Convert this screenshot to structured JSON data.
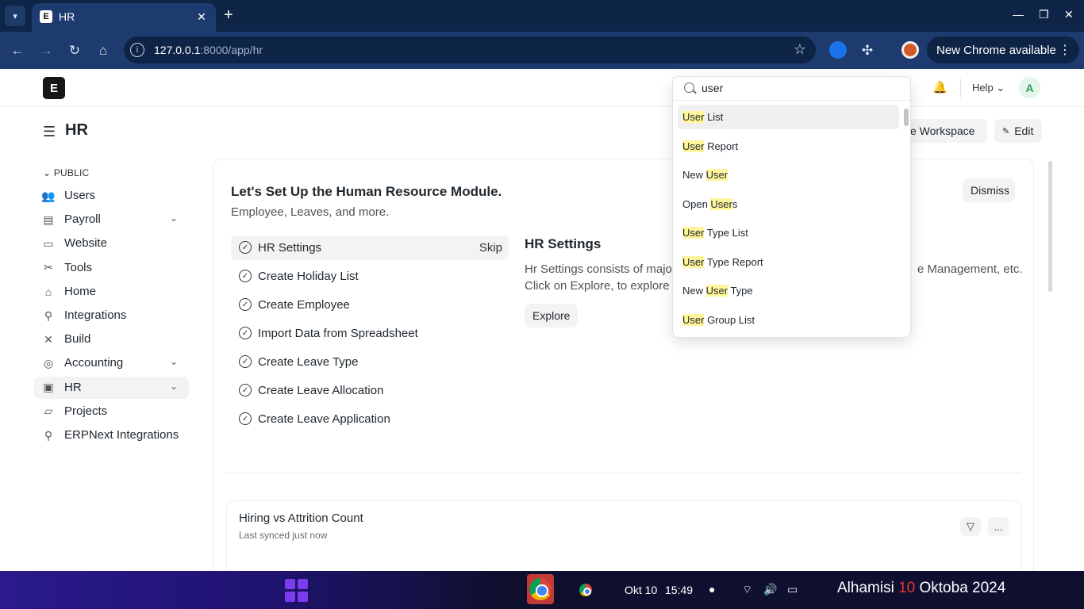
{
  "browser": {
    "tab_title": "HR",
    "tab_favicon": "E",
    "new_tab": "+",
    "url_host": "127.0.0.1",
    "url_path": ":8000/app/hr",
    "update_label": "New Chrome available"
  },
  "app": {
    "logo": "E",
    "help_label": "Help",
    "avatar_initial": "A"
  },
  "page": {
    "title": "HR",
    "workspace_button": "e Workspace",
    "edit_button": "Edit"
  },
  "sidebar": {
    "section": "PUBLIC",
    "items": [
      {
        "label": "Users",
        "icon": "users-icon",
        "chevron": false
      },
      {
        "label": "Payroll",
        "icon": "payroll-icon",
        "chevron": true
      },
      {
        "label": "Website",
        "icon": "website-icon",
        "chevron": false
      },
      {
        "label": "Tools",
        "icon": "tools-icon",
        "chevron": false
      },
      {
        "label": "Home",
        "icon": "home-icon",
        "chevron": false
      },
      {
        "label": "Integrations",
        "icon": "integrations-icon",
        "chevron": false
      },
      {
        "label": "Build",
        "icon": "build-icon",
        "chevron": false
      },
      {
        "label": "Accounting",
        "icon": "accounting-icon",
        "chevron": true
      },
      {
        "label": "HR",
        "icon": "hr-icon",
        "chevron": true
      },
      {
        "label": "Projects",
        "icon": "folder-icon",
        "chevron": false
      },
      {
        "label": "ERPNext Integrations",
        "icon": "integrations-icon",
        "chevron": false
      }
    ]
  },
  "onboarding": {
    "title": "Let's Set Up the Human Resource Module.",
    "subtitle": "Employee, Leaves, and more.",
    "dismiss": "Dismiss",
    "skip": "Skip",
    "steps": [
      "HR Settings",
      "Create Holiday List",
      "Create Employee",
      "Import Data from Spreadsheet",
      "Create Leave Type",
      "Create Leave Allocation",
      "Create Leave Application"
    ],
    "detail_title": "HR Settings",
    "detail_line1": "Hr Settings consists of major",
    "detail_line1_tail": "e Management, etc.",
    "detail_line2": "Click on Explore, to explore H",
    "explore": "Explore"
  },
  "chart": {
    "title": "Hiring vs Attrition Count",
    "synced": "Last synced just now",
    "more": "..."
  },
  "search": {
    "query": "user",
    "results": [
      {
        "pre": "",
        "hl": "User",
        "post": " List"
      },
      {
        "pre": "",
        "hl": "User",
        "post": " Report"
      },
      {
        "pre": "New ",
        "hl": "User",
        "post": ""
      },
      {
        "pre": "Open ",
        "hl": "User",
        "post": "s"
      },
      {
        "pre": "",
        "hl": "User",
        "post": " Type List"
      },
      {
        "pre": "",
        "hl": "User",
        "post": " Type Report"
      },
      {
        "pre": "New ",
        "hl": "User",
        "post": " Type"
      },
      {
        "pre": "",
        "hl": "User",
        "post": " Group List"
      }
    ]
  },
  "taskbar": {
    "date": "Okt 10",
    "time": "15:49",
    "long_date_pre": "Alhamisi ",
    "long_date_day": "10",
    "long_date_post": " Oktoba 2024"
  },
  "colors": {
    "highlight": "#fff59a",
    "browser_frame": "#1d3b6e",
    "long_date_accent": "#e53935"
  }
}
